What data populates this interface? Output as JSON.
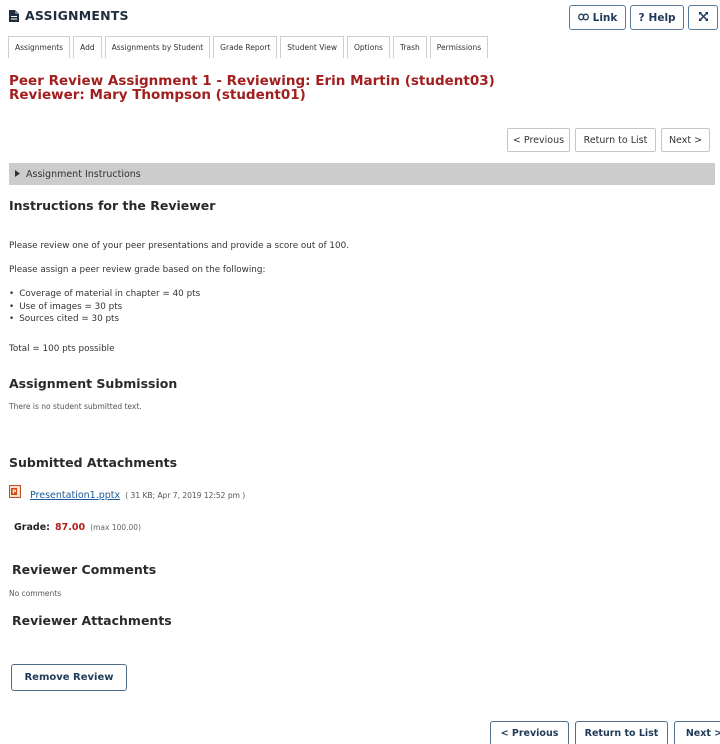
{
  "header": {
    "tool_title": "ASSIGNMENTS",
    "link_label": "Link",
    "help_label": "Help",
    "expand_icon": "expand-icon"
  },
  "tabs": [
    {
      "label": "Assignments"
    },
    {
      "label": "Add"
    },
    {
      "label": "Assignments by Student"
    },
    {
      "label": "Grade Report"
    },
    {
      "label": "Student View"
    },
    {
      "label": "Options"
    },
    {
      "label": "Trash"
    },
    {
      "label": "Permissions"
    }
  ],
  "title": {
    "line1": "Peer Review Assignment 1 - Reviewing:  Erin Martin (student03)",
    "line2": "Reviewer: Mary Thompson (student01)"
  },
  "nav_top": {
    "previous": "< Previous",
    "return": "Return to List",
    "next": "Next >"
  },
  "instructions_bar": {
    "label": "Assignment Instructions"
  },
  "instructions": {
    "heading": "Instructions for the Reviewer",
    "p1": "Please review one of your peer presentations and provide a score out of 100.",
    "p2": "Please assign a peer review grade based on the following:",
    "items": [
      "Coverage of material in chapter = 40 pts",
      "Use of images = 30 pts",
      "Sources cited = 30 pts"
    ],
    "total": "Total = 100 pts possible"
  },
  "submission": {
    "heading": "Assignment Submission",
    "text": "There is no student submitted text."
  },
  "attachments": {
    "heading": "Submitted Attachments",
    "file_name": "Presentation1.pptx",
    "file_meta": "( 31 KB; Apr 7, 2019 12:52 pm )"
  },
  "grade": {
    "label": "Grade:",
    "value": "87.00",
    "max": "(max 100.00)"
  },
  "reviewer_comments": {
    "heading": "Reviewer Comments",
    "text": "No comments"
  },
  "reviewer_attachments": {
    "heading": "Reviewer Attachments"
  },
  "remove_review": "Remove Review",
  "nav_bottom": {
    "previous": "< Previous",
    "return": "Return to List",
    "next": "Next >"
  },
  "colors": {
    "title_red": "#a11f1f",
    "link_blue": "#1a5a9a",
    "bar_gray": "#cccccc"
  }
}
